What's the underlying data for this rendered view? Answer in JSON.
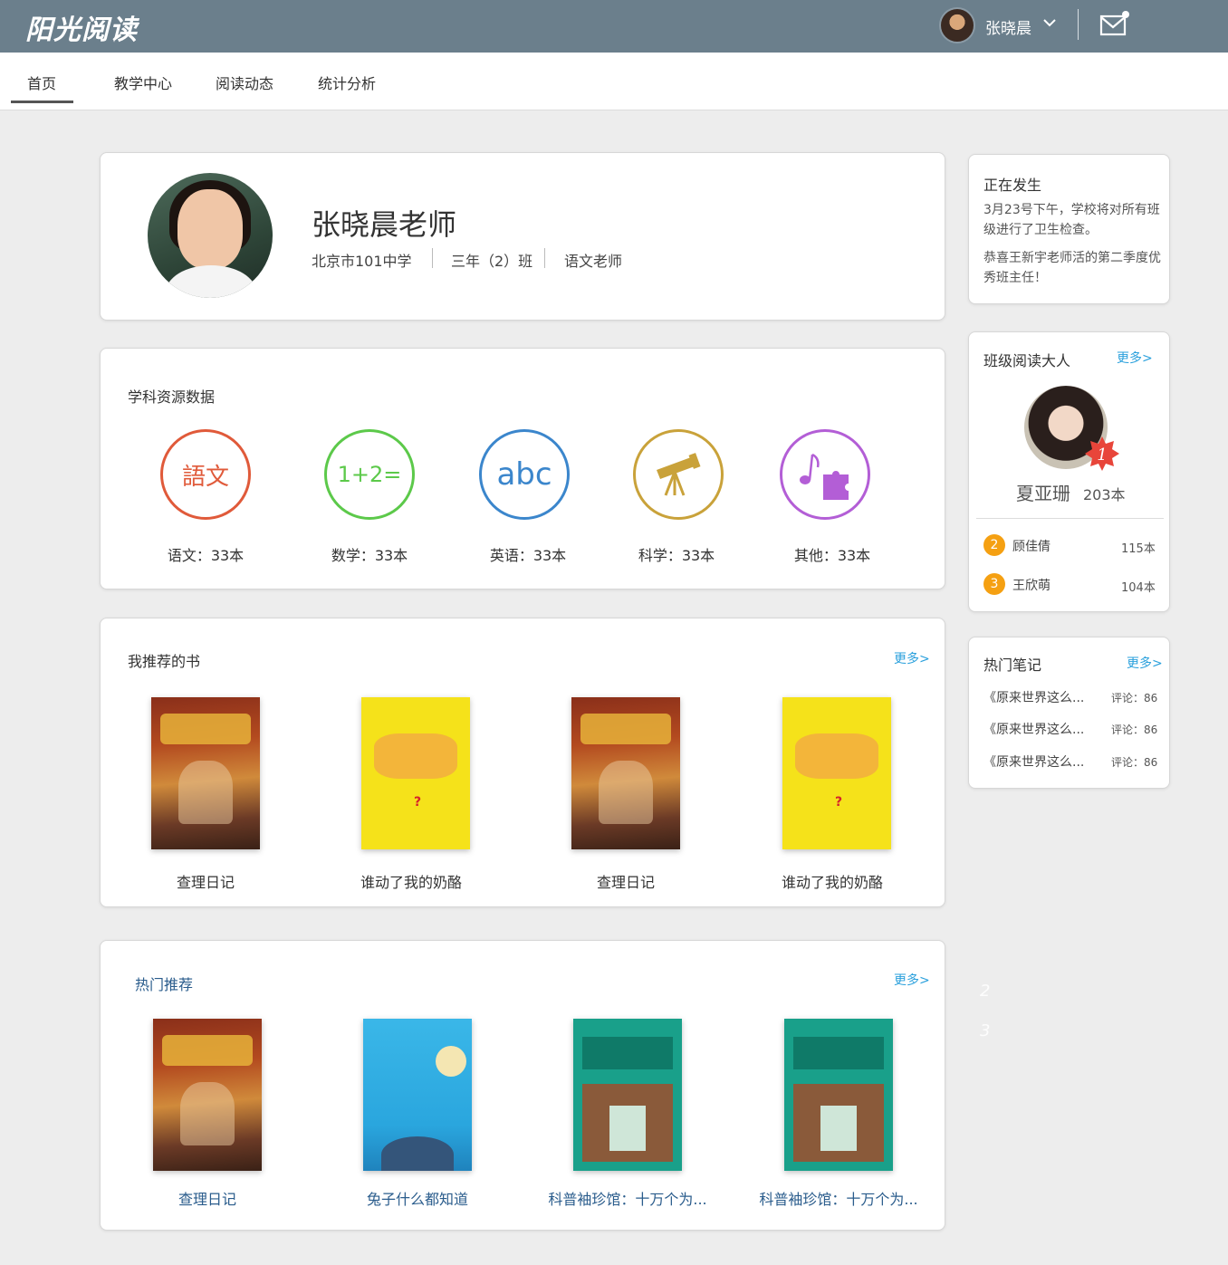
{
  "header": {
    "logo": "阳光阅读",
    "user_name": "张晓晨"
  },
  "nav": {
    "tabs": [
      {
        "label": "首页",
        "active": true
      },
      {
        "label": "教学中心",
        "active": false
      },
      {
        "label": "阅读动态",
        "active": false
      },
      {
        "label": "统计分析",
        "active": false
      }
    ]
  },
  "profile": {
    "name": "张晓晨老师",
    "school": "北京市101中学",
    "class": "三年（2）班",
    "role": "语文老师"
  },
  "subjects": {
    "title": "学科资源数据",
    "items": [
      {
        "icon": "chinese-seal-icon",
        "glyph": "語文",
        "label": "语文：33本",
        "color": "#e05a3a"
      },
      {
        "icon": "math-icon",
        "glyph": "1+2=",
        "label": "数学：33本",
        "color": "#5cc94a"
      },
      {
        "icon": "english-icon",
        "glyph": "abc",
        "label": "英语：33本",
        "color": "#3b86cc"
      },
      {
        "icon": "telescope-icon",
        "glyph": "",
        "label": "科学：33本",
        "color": "#c9a23a"
      },
      {
        "icon": "music-puzzle-icon",
        "glyph": "",
        "label": "其他：33本",
        "color": "#b35ed6"
      }
    ]
  },
  "recommended": {
    "title": "我推荐的书",
    "more": "更多>",
    "books": [
      {
        "title": "查理日记",
        "cover": "charlie"
      },
      {
        "title": "谁动了我的奶酪",
        "cover": "cheese"
      },
      {
        "title": "查理日记",
        "cover": "charlie"
      },
      {
        "title": "谁动了我的奶酪",
        "cover": "cheese"
      }
    ]
  },
  "popular": {
    "title": "热门推荐",
    "more": "更多>",
    "books": [
      {
        "title": "查理日记",
        "cover": "charlie"
      },
      {
        "title": "兔子什么都知道",
        "cover": "rabbit"
      },
      {
        "title": "科普袖珍馆：十万个为...",
        "cover": "100k"
      },
      {
        "title": "科普袖珍馆：十万个为...",
        "cover": "100k"
      }
    ]
  },
  "happening": {
    "title": "正在发生",
    "items": [
      "3月23号下午，学校将对所有班级进行了卫生检查。",
      "恭喜王新宇老师活的第二季度优秀班主任！"
    ]
  },
  "class_reader": {
    "title": "班级阅读大人",
    "more": "更多>",
    "top": {
      "rank": "1",
      "name": "夏亚珊",
      "count": "203本"
    },
    "others": [
      {
        "rank": "2",
        "name": "顾佳倩",
        "count": "115本"
      },
      {
        "rank": "3",
        "name": "王欣萌",
        "count": "104本"
      }
    ]
  },
  "hot_notes": {
    "title": "热门笔记",
    "more": "更多>",
    "items": [
      {
        "title": "《原来世界这么...",
        "count": "评论：86"
      },
      {
        "title": "《原来世界这么...",
        "count": "评论：86"
      },
      {
        "title": "《原来世界这么...",
        "count": "评论：86"
      }
    ]
  },
  "ghost_numbers": [
    "2",
    "3"
  ],
  "colors": {
    "header_bg": "#6b7f8c",
    "link": "#2aa0dc",
    "rank_badge": "#f5a012",
    "rank_one": "#e8453a"
  }
}
